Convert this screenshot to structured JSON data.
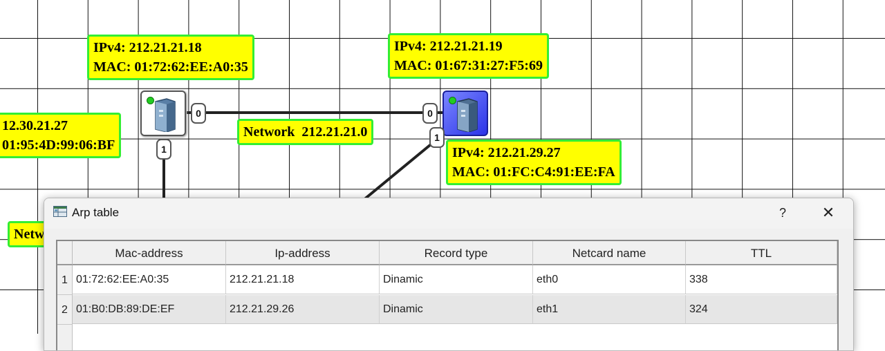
{
  "network": {
    "nodes": [
      {
        "ip": "IPv4: 212.21.21.18",
        "mac": "MAC: 01:72:62:EE:A0:35"
      },
      {
        "ip": "IPv4: 212.21.21.19",
        "mac": "MAC: 01:67:31:27:F5:69"
      },
      {
        "ip": "IPv4: 212.21.29.27",
        "mac": "MAC: 01:FC:C4:91:EE:FA"
      },
      {
        "ip": "12.30.21.27",
        "mac": "01:95:4D:99:06:BF"
      }
    ],
    "network_label": "Network  212.21.21.0",
    "partial_label": "Netw",
    "ports": {
      "left_0": "0",
      "left_1": "1",
      "right_0": "0",
      "right_1": "1"
    }
  },
  "dialog": {
    "title": "Arp table",
    "help_label": "?",
    "close_label": "✕",
    "columns": [
      "Mac-address",
      "Ip-address",
      "Record type",
      "Netcard name",
      "TTL"
    ],
    "rows": [
      {
        "index": "1",
        "cells": [
          "01:72:62:EE:A0:35",
          "212.21.21.18",
          "Dinamic",
          "eth0",
          "338"
        ]
      },
      {
        "index": "2",
        "cells": [
          "01:B0:DB:89:DE:EF",
          "212.21.29.26",
          "Dinamic",
          "eth1",
          "324"
        ]
      }
    ]
  },
  "colors": {
    "label_bg": "#ffff00",
    "label_border": "#33ee33",
    "node_blue": "#3b44f0"
  }
}
